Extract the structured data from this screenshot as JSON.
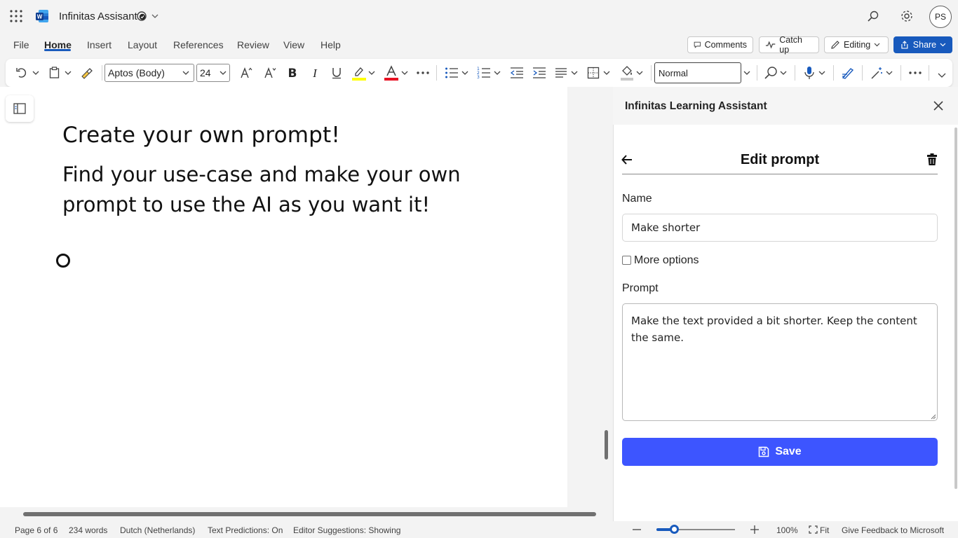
{
  "app": {
    "doc_title": "Infinitas Assisant",
    "avatar_initials": "PS"
  },
  "tabs": [
    "File",
    "Home",
    "Insert",
    "Layout",
    "References",
    "Review",
    "View",
    "Help"
  ],
  "active_tab": "Home",
  "top_buttons": {
    "comments": "Comments",
    "catch_up": "Catch up",
    "editing": "Editing",
    "share": "Share"
  },
  "ribbon": {
    "font_name": "Aptos (Body)",
    "font_size": "24",
    "style": "Normal",
    "highlight_color": "#ffff00",
    "font_color": "#e81123"
  },
  "document": {
    "heading1": "Create your own prompt!",
    "heading2": "Find your use-case and make your own prompt to use the AI as you want it!"
  },
  "panel": {
    "title": "Infinitas Learning Assistant",
    "edit_title": "Edit prompt",
    "name_label": "Name",
    "name_value": "Make shorter",
    "more_options_label": "More options",
    "more_options_checked": false,
    "prompt_label": "Prompt",
    "prompt_value": "Make the text provided a bit shorter. Keep the content the same.",
    "save_label": "Save",
    "accent_color": "#3d55ff"
  },
  "status": {
    "page": "Page 6 of 6",
    "words": "234 words",
    "language": "Dutch (Netherlands)",
    "text_predictions": "Text Predictions: On",
    "editor_suggestions": "Editor Suggestions: Showing",
    "zoom": "100%",
    "fit": "Fit",
    "feedback": "Give Feedback to Microsoft"
  }
}
